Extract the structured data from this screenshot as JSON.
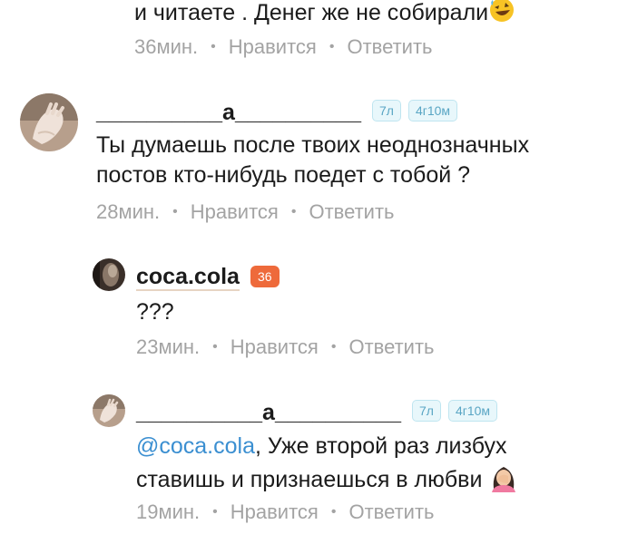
{
  "comments": [
    {
      "text_lines": [
        "и читаете . Денег же не собирали"
      ],
      "time": "36мин.",
      "like": "Нравится",
      "reply": "Ответить"
    },
    {
      "username": "__________а__________",
      "badges": [
        "7л",
        "4г10м"
      ],
      "text_lines": [
        "Ты думаешь после твоих неоднозначных",
        "постов кто-нибудь поедет с тобой ?"
      ],
      "time": "28мин.",
      "like": "Нравится",
      "reply": "Ответить"
    },
    {
      "username": "coca.cola",
      "badges": [
        "36"
      ],
      "text_lines": [
        "???"
      ],
      "time": "23мин.",
      "like": "Нравится",
      "reply": "Ответить"
    },
    {
      "username": "__________а__________",
      "badges": [
        "7л",
        "4г10м"
      ],
      "mention": "@coca.cola",
      "text_lines": [
        ", Уже второй раз лизбух",
        "ставишь и признаешься в любви"
      ],
      "time": "19мин.",
      "like": "Нравится",
      "reply": "Ответить"
    }
  ],
  "separator": "•",
  "colors": {
    "meta": "#a3a3a3",
    "mention": "#3b8fd1",
    "badge_bg": "#e8f7fb",
    "badge_text": "#5aa6c4",
    "badge_orange": "#ee6a3b"
  },
  "icons": [
    "rofl-emoji",
    "facepalm-emoji"
  ]
}
